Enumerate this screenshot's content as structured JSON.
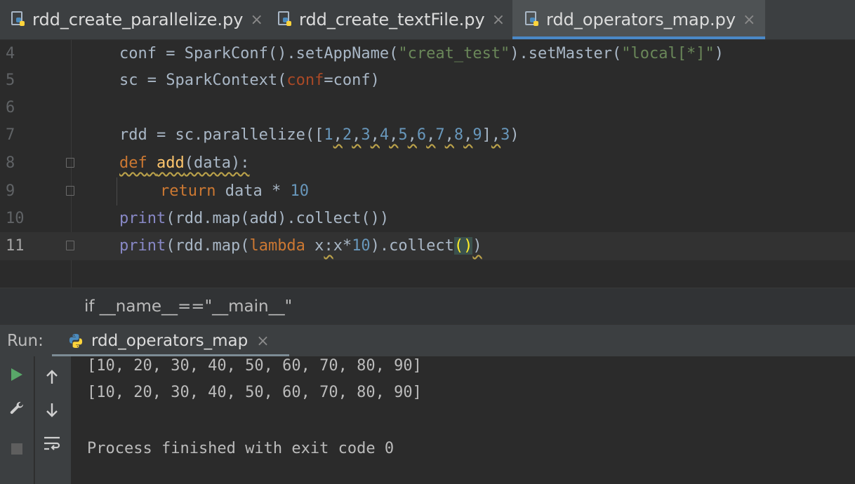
{
  "tabs": [
    {
      "label": "rdd_create_parallelize.py",
      "active": false
    },
    {
      "label": "rdd_create_textFile.py",
      "active": false
    },
    {
      "label": "rdd_operators_map.py",
      "active": true
    }
  ],
  "editor": {
    "lines": [
      {
        "num": "4"
      },
      {
        "num": "5"
      },
      {
        "num": "6"
      },
      {
        "num": "7"
      },
      {
        "num": "8"
      },
      {
        "num": "9"
      },
      {
        "num": "10"
      },
      {
        "num": "11"
      }
    ]
  },
  "breadcrumb": "if __name__==\"__main__\"",
  "run": {
    "label": "Run:",
    "tab_label": "rdd_operators_map",
    "output": [
      "[10, 20, 30, 40, 50, 60, 70, 80, 90]",
      "[10, 20, 30, 40, 50, 60, 70, 80, 90]",
      "",
      "Process finished with exit code 0"
    ]
  },
  "colors": {
    "accent": "#4a88c7",
    "run_green": "#59a869"
  }
}
